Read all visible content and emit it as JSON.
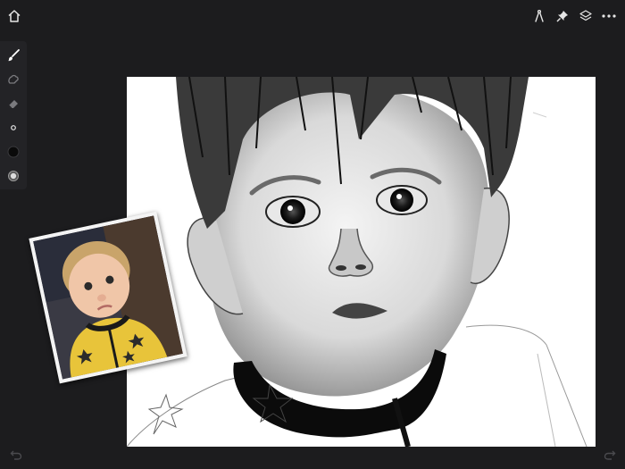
{
  "colors": {
    "background": "#1c1c1e",
    "rail": "#232326",
    "icon": "#e6e6e6",
    "icon_dim": "#7a7a7e",
    "canvas": "#ffffff",
    "primary_color_swatch": "#0a0a0a"
  },
  "topbar": {
    "home_icon": "home-icon",
    "right_icons": [
      "compass-icon",
      "pin-icon",
      "layers-icon",
      "more-icon"
    ]
  },
  "tool_rail": {
    "tools": [
      "brush-icon",
      "smudge-icon",
      "eraser-icon",
      "brush-size-icon",
      "color-swatch",
      "opacity-icon"
    ],
    "selected_tool": "brush-icon"
  },
  "canvas": {
    "content": "pencil-portrait-sketch"
  },
  "reference_photo": {
    "content": "reference-photo"
  },
  "bottom": {
    "left_icon": "undo-icon",
    "right_icon": "redo-icon"
  }
}
